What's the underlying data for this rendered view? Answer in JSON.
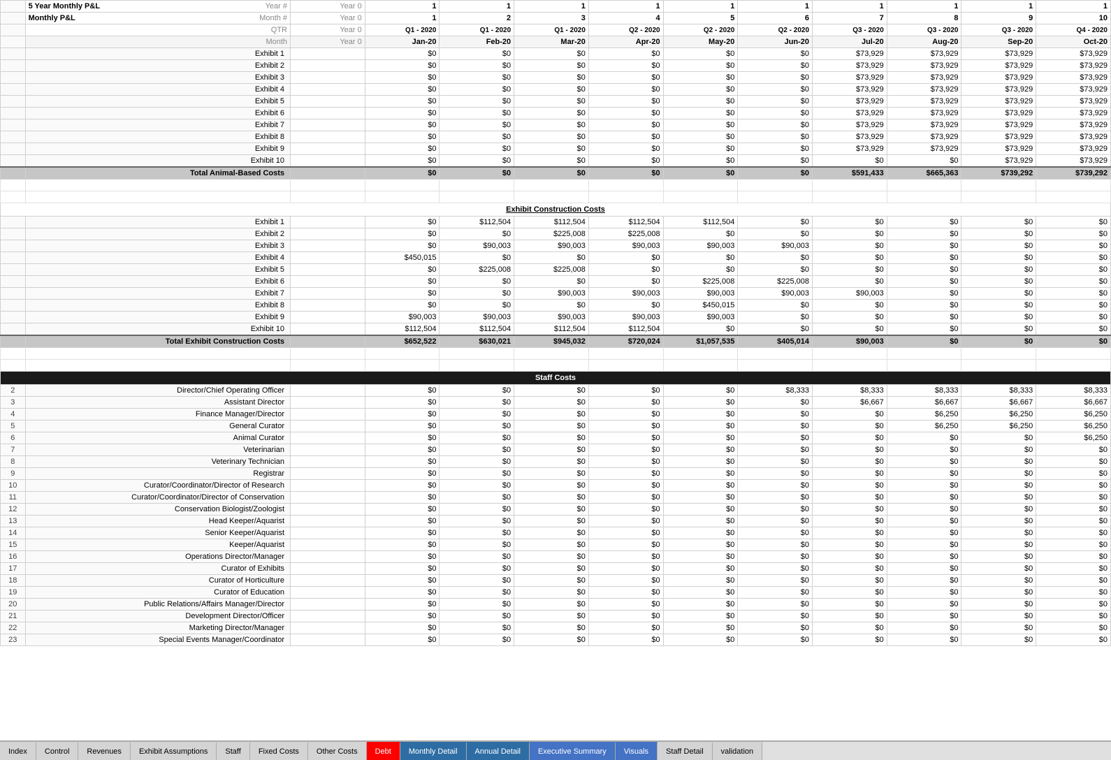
{
  "title": "5 Year Monthly P&L",
  "header": {
    "row1_label": "5 Year",
    "row2_label": "Monthly P&L",
    "year_label": "Year #",
    "month_label": "Month #",
    "qtr_label": "QTR",
    "month_row": "Month",
    "year0": "Year 0",
    "years": [
      "Year 0",
      "Year 0",
      "Year 0",
      "1",
      "1",
      "1",
      "1",
      "1",
      "1",
      "1",
      "1",
      "1",
      "1",
      "1"
    ],
    "months": [
      "Year 0",
      "1",
      "2",
      "3",
      "4",
      "5",
      "6",
      "7",
      "8",
      "9",
      "10"
    ],
    "qtrs": [
      "Year 0",
      "Q1 - 2020",
      "Q1 - 2020",
      "Q1 - 2020",
      "Q2 - 2020",
      "Q2 - 2020",
      "Q2 - 2020",
      "Q3 - 2020",
      "Q3 - 2020",
      "Q3 - 2020",
      "Q4 - 2020"
    ],
    "month_names": [
      "Year 0",
      "Jan-20",
      "Feb-20",
      "Mar-20",
      "Apr-20",
      "May-20",
      "Jun-20",
      "Jul-20",
      "Aug-20",
      "Sep-20",
      "Oct-20"
    ]
  },
  "exhibits_animal": {
    "rows": [
      {
        "label": "Exhibit 1",
        "values": [
          "$0",
          "$0",
          "$0",
          "$0",
          "$0",
          "$0",
          "$73,929",
          "$73,929",
          "$73,929",
          "$73,929"
        ]
      },
      {
        "label": "Exhibit 2",
        "values": [
          "$0",
          "$0",
          "$0",
          "$0",
          "$0",
          "$0",
          "$73,929",
          "$73,929",
          "$73,929",
          "$73,929"
        ]
      },
      {
        "label": "Exhibit 3",
        "values": [
          "$0",
          "$0",
          "$0",
          "$0",
          "$0",
          "$0",
          "$73,929",
          "$73,929",
          "$73,929",
          "$73,929"
        ]
      },
      {
        "label": "Exhibit 4",
        "values": [
          "$0",
          "$0",
          "$0",
          "$0",
          "$0",
          "$0",
          "$73,929",
          "$73,929",
          "$73,929",
          "$73,929"
        ]
      },
      {
        "label": "Exhibit 5",
        "values": [
          "$0",
          "$0",
          "$0",
          "$0",
          "$0",
          "$0",
          "$73,929",
          "$73,929",
          "$73,929",
          "$73,929"
        ]
      },
      {
        "label": "Exhibit 6",
        "values": [
          "$0",
          "$0",
          "$0",
          "$0",
          "$0",
          "$0",
          "$73,929",
          "$73,929",
          "$73,929",
          "$73,929"
        ]
      },
      {
        "label": "Exhibit 7",
        "values": [
          "$0",
          "$0",
          "$0",
          "$0",
          "$0",
          "$0",
          "$73,929",
          "$73,929",
          "$73,929",
          "$73,929"
        ]
      },
      {
        "label": "Exhibit 8",
        "values": [
          "$0",
          "$0",
          "$0",
          "$0",
          "$0",
          "$0",
          "$73,929",
          "$73,929",
          "$73,929",
          "$73,929"
        ]
      },
      {
        "label": "Exhibit 9",
        "values": [
          "$0",
          "$0",
          "$0",
          "$0",
          "$0",
          "$0",
          "$73,929",
          "$73,929",
          "$73,929",
          "$73,929"
        ]
      },
      {
        "label": "Exhibit 10",
        "values": [
          "$0",
          "$0",
          "$0",
          "$0",
          "$0",
          "$0",
          "$0",
          "$0",
          "$73,929",
          "$73,929"
        ]
      }
    ],
    "total_label": "Total Animal-Based Costs",
    "total_values": [
      "$0",
      "$0",
      "$0",
      "$0",
      "$0",
      "$0",
      "$591,433",
      "$665,363",
      "$739,292",
      "$739,292"
    ]
  },
  "exhibits_construction": {
    "section_title": "Exhibit Construction Costs",
    "rows": [
      {
        "label": "Exhibit 1",
        "values": [
          "$0",
          "$112,504",
          "$112,504",
          "$112,504",
          "$112,504",
          "$0",
          "$0",
          "$0",
          "$0",
          "$0"
        ]
      },
      {
        "label": "Exhibit 2",
        "values": [
          "$0",
          "$0",
          "$225,008",
          "$225,008",
          "$0",
          "$0",
          "$0",
          "$0",
          "$0",
          "$0"
        ]
      },
      {
        "label": "Exhibit 3",
        "values": [
          "$0",
          "$90,003",
          "$90,003",
          "$90,003",
          "$90,003",
          "$90,003",
          "$0",
          "$0",
          "$0",
          "$0"
        ]
      },
      {
        "label": "Exhibit 4",
        "values": [
          "$450,015",
          "$0",
          "$0",
          "$0",
          "$0",
          "$0",
          "$0",
          "$0",
          "$0",
          "$0"
        ]
      },
      {
        "label": "Exhibit 5",
        "values": [
          "$0",
          "$225,008",
          "$225,008",
          "$0",
          "$0",
          "$0",
          "$0",
          "$0",
          "$0",
          "$0"
        ]
      },
      {
        "label": "Exhibit 6",
        "values": [
          "$0",
          "$0",
          "$0",
          "$0",
          "$225,008",
          "$225,008",
          "$0",
          "$0",
          "$0",
          "$0"
        ]
      },
      {
        "label": "Exhibit 7",
        "values": [
          "$0",
          "$0",
          "$90,003",
          "$90,003",
          "$90,003",
          "$90,003",
          "$90,003",
          "$0",
          "$0",
          "$0"
        ]
      },
      {
        "label": "Exhibit 8",
        "values": [
          "$0",
          "$0",
          "$0",
          "$0",
          "$450,015",
          "$0",
          "$0",
          "$0",
          "$0",
          "$0"
        ]
      },
      {
        "label": "Exhibit 9",
        "values": [
          "$90,003",
          "$90,003",
          "$90,003",
          "$90,003",
          "$90,003",
          "$0",
          "$0",
          "$0",
          "$0",
          "$0"
        ]
      },
      {
        "label": "Exhibit 10",
        "values": [
          "$112,504",
          "$112,504",
          "$112,504",
          "$112,504",
          "$0",
          "$0",
          "$0",
          "$0",
          "$0",
          "$0"
        ]
      }
    ],
    "total_label": "Total Exhibit Construction Costs",
    "total_values": [
      "$652,522",
      "$630,021",
      "$945,032",
      "$720,024",
      "$1,057,535",
      "$405,014",
      "$90,003",
      "$0",
      "$0",
      "$0"
    ]
  },
  "staff_costs": {
    "section_title": "Staff Costs",
    "rows": [
      {
        "index": "2",
        "label": "Director/Chief Operating Officer",
        "values": [
          "$0",
          "$0",
          "$0",
          "$0",
          "$0",
          "$8,333",
          "$8,333",
          "$8,333",
          "$8,333",
          "$8,333"
        ]
      },
      {
        "index": "3",
        "label": "Assistant Director",
        "values": [
          "$0",
          "$0",
          "$0",
          "$0",
          "$0",
          "$0",
          "$6,667",
          "$6,667",
          "$6,667",
          "$6,667"
        ]
      },
      {
        "index": "4",
        "label": "Finance Manager/Director",
        "values": [
          "$0",
          "$0",
          "$0",
          "$0",
          "$0",
          "$0",
          "$0",
          "$6,250",
          "$6,250",
          "$6,250"
        ]
      },
      {
        "index": "5",
        "label": "General Curator",
        "values": [
          "$0",
          "$0",
          "$0",
          "$0",
          "$0",
          "$0",
          "$0",
          "$6,250",
          "$6,250",
          "$6,250"
        ]
      },
      {
        "index": "6",
        "label": "Animal Curator",
        "values": [
          "$0",
          "$0",
          "$0",
          "$0",
          "$0",
          "$0",
          "$0",
          "$0",
          "$0",
          "$6,250"
        ]
      },
      {
        "index": "7",
        "label": "Veterinarian",
        "values": [
          "$0",
          "$0",
          "$0",
          "$0",
          "$0",
          "$0",
          "$0",
          "$0",
          "$0",
          "$0"
        ]
      },
      {
        "index": "8",
        "label": "Veterinary Technician",
        "values": [
          "$0",
          "$0",
          "$0",
          "$0",
          "$0",
          "$0",
          "$0",
          "$0",
          "$0",
          "$0"
        ]
      },
      {
        "index": "9",
        "label": "Registrar",
        "values": [
          "$0",
          "$0",
          "$0",
          "$0",
          "$0",
          "$0",
          "$0",
          "$0",
          "$0",
          "$0"
        ]
      },
      {
        "index": "10",
        "label": "Curator/Coordinator/Director of Research",
        "values": [
          "$0",
          "$0",
          "$0",
          "$0",
          "$0",
          "$0",
          "$0",
          "$0",
          "$0",
          "$0"
        ]
      },
      {
        "index": "11",
        "label": "Curator/Coordinator/Director of Conservation",
        "values": [
          "$0",
          "$0",
          "$0",
          "$0",
          "$0",
          "$0",
          "$0",
          "$0",
          "$0",
          "$0"
        ]
      },
      {
        "index": "12",
        "label": "Conservation Biologist/Zoologist",
        "values": [
          "$0",
          "$0",
          "$0",
          "$0",
          "$0",
          "$0",
          "$0",
          "$0",
          "$0",
          "$0"
        ]
      },
      {
        "index": "13",
        "label": "Head Keeper/Aquarist",
        "values": [
          "$0",
          "$0",
          "$0",
          "$0",
          "$0",
          "$0",
          "$0",
          "$0",
          "$0",
          "$0"
        ]
      },
      {
        "index": "14",
        "label": "Senior Keeper/Aquarist",
        "values": [
          "$0",
          "$0",
          "$0",
          "$0",
          "$0",
          "$0",
          "$0",
          "$0",
          "$0",
          "$0"
        ]
      },
      {
        "index": "15",
        "label": "Keeper/Aquarist",
        "values": [
          "$0",
          "$0",
          "$0",
          "$0",
          "$0",
          "$0",
          "$0",
          "$0",
          "$0",
          "$0"
        ]
      },
      {
        "index": "16",
        "label": "Operations Director/Manager",
        "values": [
          "$0",
          "$0",
          "$0",
          "$0",
          "$0",
          "$0",
          "$0",
          "$0",
          "$0",
          "$0"
        ]
      },
      {
        "index": "17",
        "label": "Curator of Exhibits",
        "values": [
          "$0",
          "$0",
          "$0",
          "$0",
          "$0",
          "$0",
          "$0",
          "$0",
          "$0",
          "$0"
        ]
      },
      {
        "index": "18",
        "label": "Curator of Horticulture",
        "values": [
          "$0",
          "$0",
          "$0",
          "$0",
          "$0",
          "$0",
          "$0",
          "$0",
          "$0",
          "$0"
        ]
      },
      {
        "index": "19",
        "label": "Curator of Education",
        "values": [
          "$0",
          "$0",
          "$0",
          "$0",
          "$0",
          "$0",
          "$0",
          "$0",
          "$0",
          "$0"
        ]
      },
      {
        "index": "20",
        "label": "Public Relations/Affairs Manager/Director",
        "values": [
          "$0",
          "$0",
          "$0",
          "$0",
          "$0",
          "$0",
          "$0",
          "$0",
          "$0",
          "$0"
        ]
      },
      {
        "index": "21",
        "label": "Development Director/Officer",
        "values": [
          "$0",
          "$0",
          "$0",
          "$0",
          "$0",
          "$0",
          "$0",
          "$0",
          "$0",
          "$0"
        ]
      },
      {
        "index": "22",
        "label": "Marketing Director/Manager",
        "values": [
          "$0",
          "$0",
          "$0",
          "$0",
          "$0",
          "$0",
          "$0",
          "$0",
          "$0",
          "$0"
        ]
      },
      {
        "index": "23",
        "label": "Special Events Manager/Coordinator",
        "values": [
          "$0",
          "$0",
          "$0",
          "$0",
          "$0",
          "$0",
          "$0",
          "$0",
          "$0",
          "$0"
        ]
      }
    ]
  },
  "tabs": [
    {
      "label": "Index",
      "active": false,
      "style": "normal"
    },
    {
      "label": "Control",
      "active": false,
      "style": "normal"
    },
    {
      "label": "Revenues",
      "active": false,
      "style": "normal"
    },
    {
      "label": "Exhibit Assumptions",
      "active": false,
      "style": "normal"
    },
    {
      "label": "Staff",
      "active": false,
      "style": "normal"
    },
    {
      "label": "Fixed Costs",
      "active": false,
      "style": "normal"
    },
    {
      "label": "Other Costs",
      "active": false,
      "style": "normal"
    },
    {
      "label": "Debt",
      "active": false,
      "style": "red"
    },
    {
      "label": "Monthly Detail",
      "active": true,
      "style": "blue-dark"
    },
    {
      "label": "Annual Detail",
      "active": false,
      "style": "blue-dark"
    },
    {
      "label": "Executive Summary",
      "active": false,
      "style": "blue-mid"
    },
    {
      "label": "Visuals",
      "active": false,
      "style": "blue-mid"
    },
    {
      "label": "Staff Detail",
      "active": false,
      "style": "normal"
    },
    {
      "label": "validation",
      "active": false,
      "style": "normal"
    }
  ]
}
